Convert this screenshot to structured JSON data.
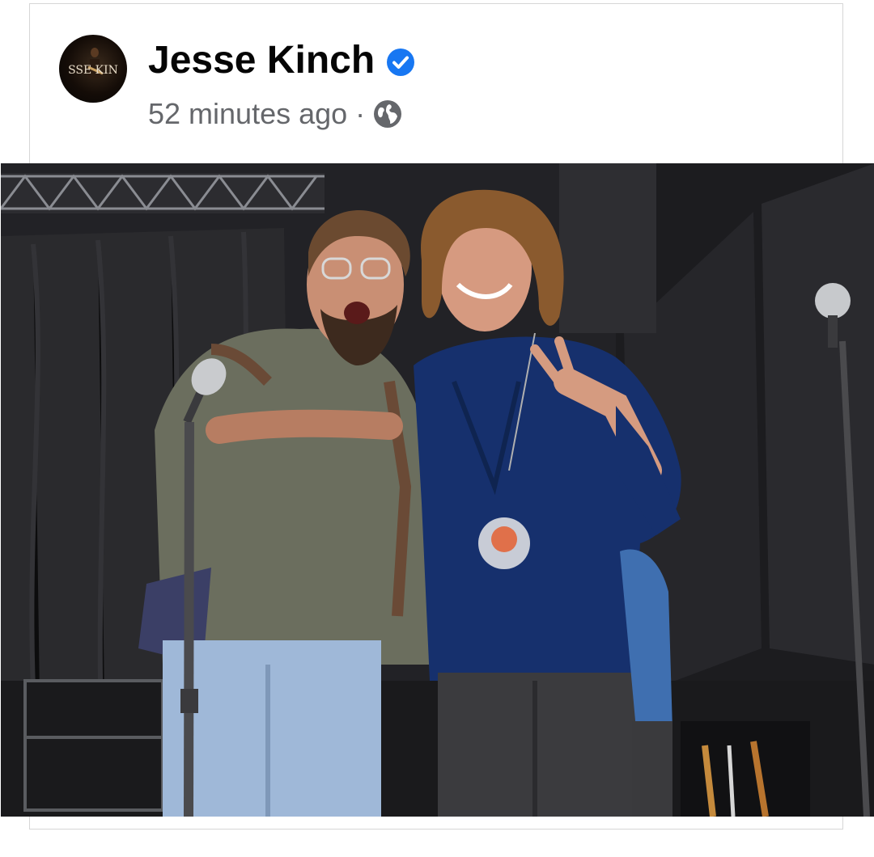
{
  "post": {
    "author_name": "Jesse Kinch",
    "timestamp": "52 minutes ago",
    "separator": "·",
    "audience_icon": "globe-icon",
    "verified_icon": "verified-badge-icon",
    "avatar_text": "SSE KIN",
    "photo_description_icon": "stage-photo"
  },
  "colors": {
    "name": "#050505",
    "meta": "#65676b",
    "verified": "#1877f2"
  }
}
